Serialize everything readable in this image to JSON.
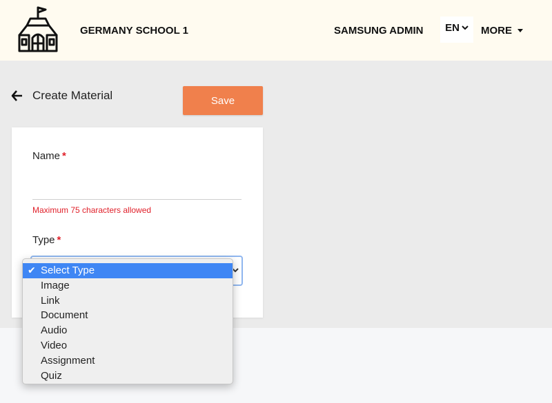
{
  "header": {
    "school_name": "GERMANY SCHOOL 1",
    "user_name": "SAMSUNG ADMIN",
    "language": "EN",
    "more_label": "MORE",
    "logo_icon": "school-building-icon"
  },
  "page": {
    "title": "Create Material",
    "back_icon": "arrow-left-icon",
    "save_label": "Save"
  },
  "form": {
    "name_label": "Name",
    "name_required_mark": "*",
    "name_value": "",
    "name_hint": "Maximum 75 characters allowed",
    "type_label": "Type",
    "type_required_mark": "*",
    "type_selected": "Select Type"
  },
  "type_options": [
    {
      "label": "Select Type",
      "selected": true
    },
    {
      "label": "Image",
      "selected": false
    },
    {
      "label": "Link",
      "selected": false
    },
    {
      "label": "Document",
      "selected": false
    },
    {
      "label": "Audio",
      "selected": false
    },
    {
      "label": "Video",
      "selected": false
    },
    {
      "label": "Assignment",
      "selected": false
    },
    {
      "label": "Quiz",
      "selected": false
    }
  ],
  "colors": {
    "header_bg": "#fffbf0",
    "content_bg": "#ebebeb",
    "accent": "#f0804c",
    "error": "#e0202a",
    "selection": "#3f86f4"
  }
}
